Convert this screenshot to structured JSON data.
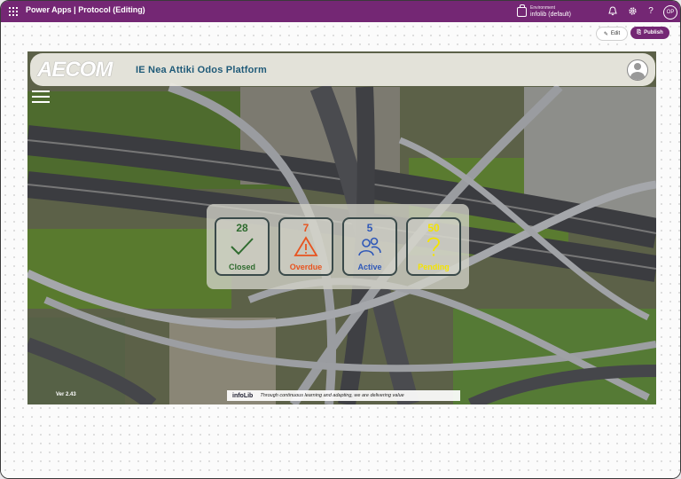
{
  "topbar": {
    "app_name": "Power Apps | Protocol (Editing)",
    "environment_label": "Environment",
    "environment_value": "infolib (default)",
    "bell_icon": "bell-icon",
    "settings_icon": "gear-icon",
    "help_icon": "question-icon",
    "user_initials": "OP"
  },
  "editor": {
    "edit_label": "Edit",
    "publish_label": "Publish",
    "device_icons": [
      "tablet-icon",
      "phone-icon",
      "database-icon"
    ]
  },
  "app": {
    "logo_text": "AECOM",
    "title": "IE Nea Attiki Odos Platform",
    "version": "Ver 2.43",
    "footer_logo": "infoLib",
    "tagline": "Through continuous learning and adapting, we are delivering value",
    "tiles": [
      {
        "count": "28",
        "label": "Closed",
        "icon": "checkmark-icon",
        "color": "#2f6b2f"
      },
      {
        "count": "7",
        "label": "Overdue",
        "icon": "warning-icon",
        "color": "#e8541f"
      },
      {
        "count": "5",
        "label": "Active",
        "icon": "people-icon",
        "color": "#2f58b8"
      },
      {
        "count": "50",
        "label": "Pending",
        "icon": "question-icon",
        "color": "#f4e400"
      }
    ]
  }
}
